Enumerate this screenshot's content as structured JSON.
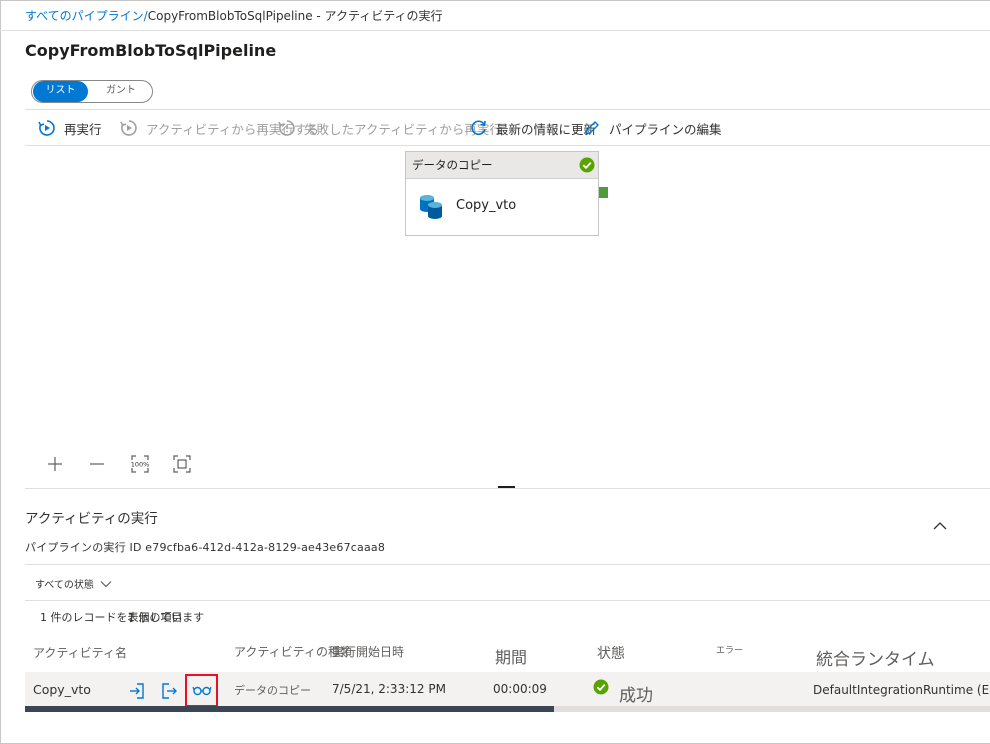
{
  "breadcrumb": {
    "link": "すべてのパイプライン/",
    "rest": "CopyFromBlobToSqlPipeline - アクティビティの実行"
  },
  "page_title": "CopyFromBlobToSqlPipeline",
  "view_toggle": {
    "list": "リスト",
    "gantt": "ガント"
  },
  "toolbar": {
    "rerun": "再実行",
    "rerun_from_activity": "アクティビティから再実行する",
    "rerun_from_failed": "失敗したアクティビティから再実行",
    "refresh": "最新の情報に更新",
    "edit_pipeline": "パイプラインの編集"
  },
  "activity_card": {
    "header": "データのコピー",
    "name": "Copy_vto",
    "status_color": "#57a300"
  },
  "canvas_tools": [
    "zoom-in",
    "zoom-out",
    "zoom-100",
    "fit-to-screen"
  ],
  "zoom_label": "100%",
  "runs_section": {
    "title": "アクティビティの実行",
    "run_id": "パイプラインの実行 ID e79cfba6-412d-412a-8129-ae43e67caaa8",
    "filter": "すべての状態",
    "record_count": "1 件のレコードを表示しています",
    "overlay_text": "1 個の項目",
    "columns": {
      "name": "アクティビティ名",
      "type": "アクティビティの種類",
      "start": "実行開始日時",
      "duration": "期間",
      "status": "状態",
      "error": "エラー",
      "runtime": "統合ランタイム"
    },
    "rows": [
      {
        "name": "Copy_vto",
        "type": "データのコピー",
        "start": "7/5/21, 2:33:12 PM",
        "duration": "00:00:09",
        "status": "成功",
        "runtime": "DefaultIntegrationRuntime (East US)"
      }
    ]
  },
  "colors": {
    "accent": "#0078d4",
    "success": "#57a300",
    "highlight": "#e81123"
  }
}
